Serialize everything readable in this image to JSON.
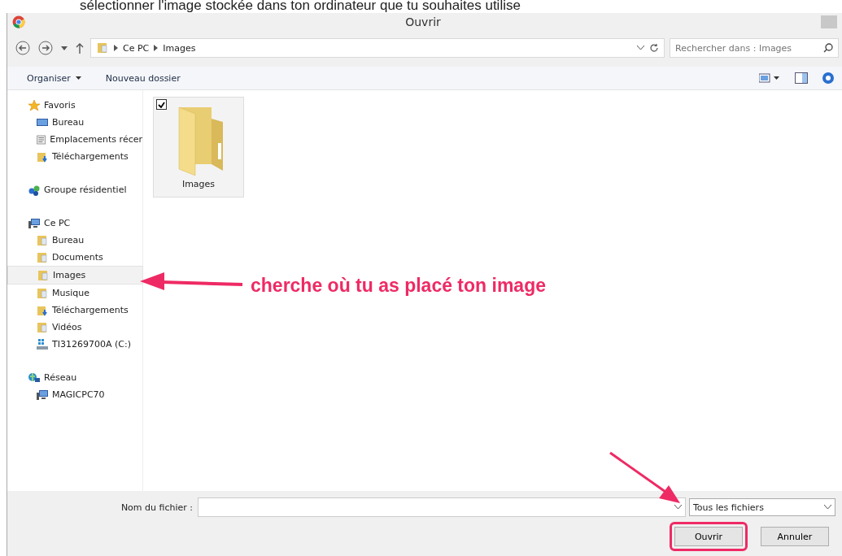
{
  "caption": "sélectionner l'image stockée dans ton ordinateur que tu souhaites utilise",
  "window": {
    "title": "Ouvrir"
  },
  "address": {
    "path": [
      "Ce PC",
      "Images"
    ]
  },
  "search": {
    "placeholder": "Rechercher dans : Images"
  },
  "toolbar": {
    "buttons": [
      {
        "label": "Organiser",
        "kind": "menu"
      },
      {
        "label": "Nouveau dossier",
        "kind": "plain"
      }
    ]
  },
  "sidebar": {
    "groups": [
      {
        "label": "Favoris",
        "kind": "star",
        "selected": false,
        "children": [
          {
            "label": "Bureau",
            "kind": "desktop",
            "selected": false
          },
          {
            "label": "Emplacements récer",
            "kind": "recent",
            "selected": false
          },
          {
            "label": "Téléchargements",
            "kind": "download",
            "selected": false
          }
        ]
      },
      {
        "label": "Groupe résidentiel",
        "kind": "homegroup",
        "selected": false
      },
      {
        "label": "Ce PC",
        "kind": "pc",
        "selected": false,
        "children": [
          {
            "label": "Bureau",
            "kind": "folder",
            "selected": false
          },
          {
            "label": "Documents",
            "kind": "folder",
            "selected": false
          },
          {
            "label": "Images",
            "kind": "folder",
            "selected": true
          },
          {
            "label": "Musique",
            "kind": "folder",
            "selected": false
          },
          {
            "label": "Téléchargements",
            "kind": "download",
            "selected": false
          },
          {
            "label": "Vidéos",
            "kind": "folder",
            "selected": false
          },
          {
            "label": "TI31269700A (C:)",
            "kind": "drive",
            "selected": false
          }
        ]
      },
      {
        "label": "Réseau",
        "kind": "network",
        "selected": false,
        "children": [
          {
            "label": "MAGICPC70",
            "kind": "pc",
            "selected": false
          }
        ]
      }
    ]
  },
  "files": [
    {
      "name": "Images",
      "checked": true
    }
  ],
  "filename": {
    "label": "Nom du fichier :"
  },
  "filetype": {
    "value": "Tous les fichiers"
  },
  "buttons": [
    {
      "label": "Ouvrir",
      "circled": true
    },
    {
      "label": "Annuler",
      "circled": false
    }
  ],
  "annotation": {
    "note": "cherche où tu as placé ton image"
  }
}
